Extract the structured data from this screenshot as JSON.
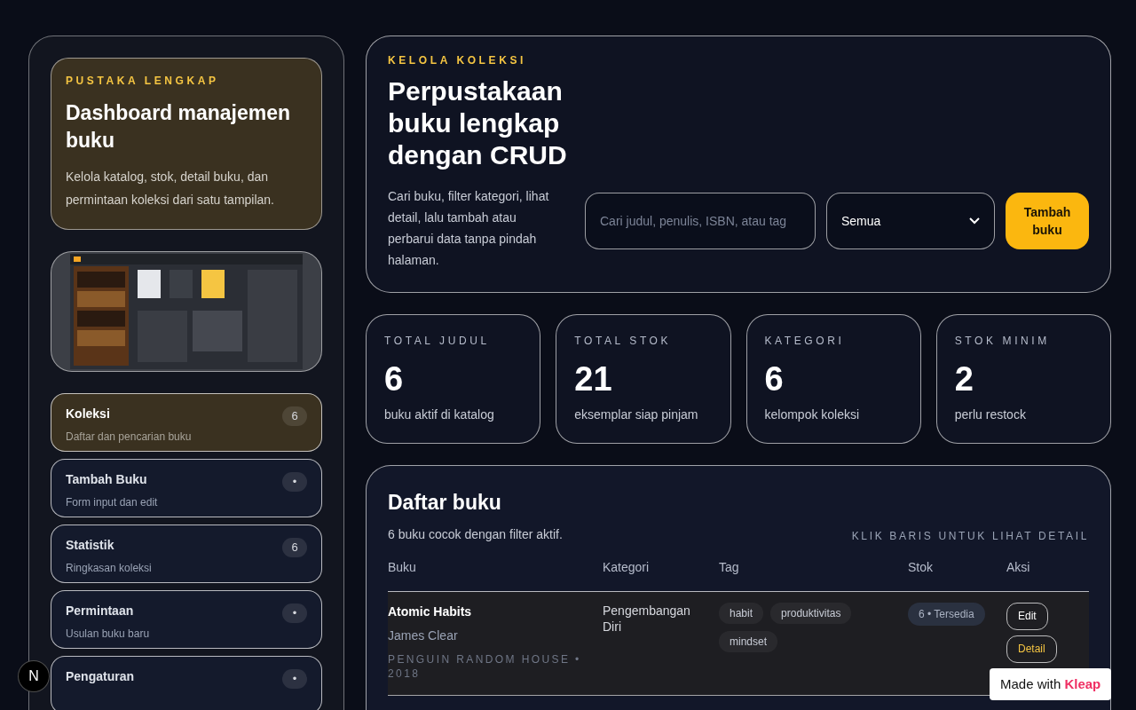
{
  "sidebar": {
    "brand": {
      "eyebrow": "PUSTAKA LENGKAP",
      "title": "Dashboard manajemen buku",
      "description": "Kelola katalog, stok, detail buku, dan permintaan koleksi dari satu tampilan."
    },
    "nav": [
      {
        "label": "Koleksi",
        "sub": "Daftar dan pencarian buku",
        "badge": "6",
        "selected": true
      },
      {
        "label": "Tambah Buku",
        "sub": "Form input dan edit",
        "badge": "•",
        "selected": false
      },
      {
        "label": "Statistik",
        "sub": "Ringkasan koleksi",
        "badge": "6",
        "selected": false
      },
      {
        "label": "Permintaan",
        "sub": "Usulan buku baru",
        "badge": "•",
        "selected": false
      },
      {
        "label": "Pengaturan",
        "badge": "•",
        "selected": false
      }
    ]
  },
  "hero": {
    "eyebrow": "KELOLA KOLEKSI",
    "title": "Perpustakaan buku lengkap dengan CRUD",
    "description": "Cari buku, filter kategori, lihat detail, lalu tambah atau perbarui data tanpa pindah halaman.",
    "search": {
      "placeholder": "Cari judul, penulis, ISBN, atau tag"
    },
    "filter": {
      "value": "Semua"
    },
    "add_button": "Tambah buku"
  },
  "stats": [
    {
      "label": "TOTAL JUDUL",
      "value": "6",
      "caption": "buku aktif di katalog"
    },
    {
      "label": "TOTAL STOK",
      "value": "21",
      "caption": "eksemplar siap pinjam"
    },
    {
      "label": "KATEGORI",
      "value": "6",
      "caption": "kelompok koleksi"
    },
    {
      "label": "STOK MINIM",
      "value": "2",
      "caption": "perlu restock"
    }
  ],
  "book_list": {
    "title": "Daftar buku",
    "summary": "6 buku cocok dengan filter aktif.",
    "hint": "KLIK BARIS UNTUK LIHAT DETAIL",
    "columns": [
      "Buku",
      "Kategori",
      "Tag",
      "Stok",
      "Aksi"
    ],
    "rows": [
      {
        "title": "Atomic Habits",
        "author": "James Clear",
        "publisher": "PENGUIN RANDOM HOUSE • 2018",
        "category": "Pengembangan Diri",
        "tags": [
          "habit",
          "produktivitas",
          "mindset"
        ],
        "stock": "6 • Tersedia",
        "actions": [
          "Edit",
          "Detail"
        ],
        "selected": true
      }
    ]
  },
  "dev_indicator": "N",
  "made_with": {
    "text": "Made with",
    "brand": "Kleap"
  }
}
